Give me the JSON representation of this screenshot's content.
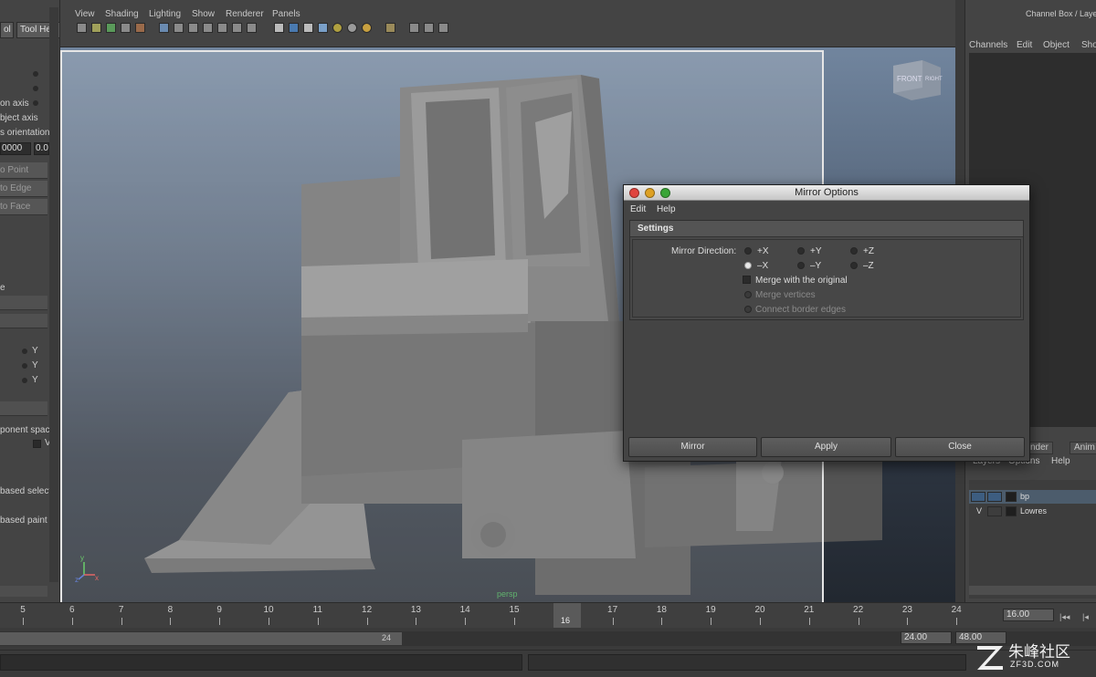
{
  "left_panel": {
    "tabs": [
      "ol",
      "Tool Help"
    ],
    "labels": [
      "on axis",
      "bject axis",
      "s orientation",
      "ponent spaci",
      "based select",
      "based paint"
    ],
    "fields": [
      "0000",
      "0.0"
    ],
    "buttons": [
      "o Point",
      "to Edge",
      "to Face"
    ],
    "axis_letters": [
      "Y",
      "Y",
      "Y"
    ],
    "small_letters": [
      "e",
      "V"
    ]
  },
  "menubar": {
    "items": [
      "View",
      "Shading",
      "Lighting",
      "Show",
      "Renderer",
      "Panels"
    ]
  },
  "viewport": {
    "view_cube_labels": [
      "FRONT",
      "RIGHT"
    ],
    "camera_label": "persp",
    "axis_labels": [
      "y",
      "x",
      "z"
    ]
  },
  "channel_box": {
    "title": "Channel Box / Layer",
    "menus": [
      "Channels",
      "Edit",
      "Object",
      "Show"
    ],
    "tabs": [
      "nder",
      "Anim"
    ],
    "layer_menus": [
      "Layers",
      "Options",
      "Help"
    ],
    "layers": [
      {
        "visibility": "",
        "name": "bp"
      },
      {
        "visibility": "V",
        "name": "Lowres"
      }
    ]
  },
  "timeline": {
    "ticks": [
      "5",
      "6",
      "7",
      "8",
      "9",
      "10",
      "11",
      "12",
      "13",
      "14",
      "15",
      "16",
      "17",
      "18",
      "19",
      "20",
      "21",
      "22",
      "23",
      "24"
    ],
    "current_frame": "16",
    "current_field": "16.00",
    "range_marker": "24",
    "range_start": "24.00",
    "range_end": "48.00"
  },
  "dialog": {
    "title": "Mirror Options",
    "menus": [
      "Edit",
      "Help"
    ],
    "section_title": "Settings",
    "mirror_direction_label": "Mirror Direction:",
    "directions": [
      {
        "label": "+X",
        "selected": false
      },
      {
        "label": "+Y",
        "selected": false
      },
      {
        "label": "+Z",
        "selected": false
      },
      {
        "label": "–X",
        "selected": true
      },
      {
        "label": "–Y",
        "selected": false
      },
      {
        "label": "–Z",
        "selected": false
      }
    ],
    "merge_label": "Merge with the original",
    "merge_vertices_label": "Merge vertices",
    "connect_border_label": "Connect border edges",
    "buttons": {
      "mirror": "Mirror",
      "apply": "Apply",
      "close": "Close"
    }
  },
  "watermark": {
    "zh": "朱峰社区",
    "en": "ZF3D.COM"
  },
  "colors": {
    "close_dot": "#e0443e",
    "min_dot": "#dea123",
    "max_dot": "#39a537",
    "layer_blue": "#3d5d80"
  }
}
